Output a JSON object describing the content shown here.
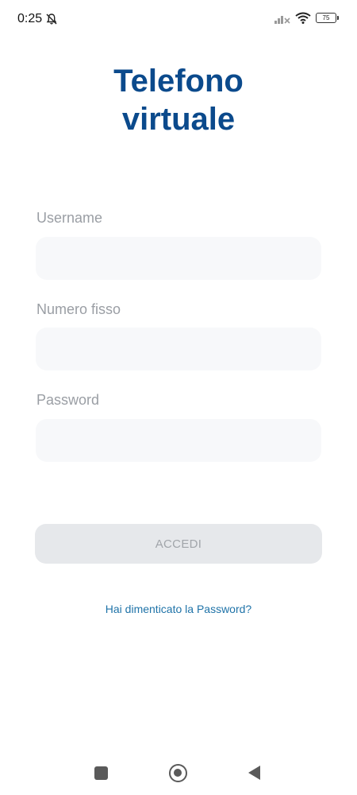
{
  "status_bar": {
    "time": "0:25",
    "battery_level": "75",
    "icons": [
      "bell-muted-icon",
      "signal-off-icon",
      "wifi-icon",
      "battery-icon"
    ]
  },
  "header": {
    "title_line1": "Telefono",
    "title_line2": "virtuale"
  },
  "form": {
    "username_label": "Username",
    "username_value": "",
    "landline_label": "Numero fisso",
    "landline_value": "",
    "password_label": "Password",
    "password_value": "",
    "submit_label": "ACCEDI",
    "forgot_link": "Hai dimenticato la Password?"
  },
  "nav_bar": {
    "icons": [
      "recents-icon",
      "home-icon",
      "back-icon"
    ]
  },
  "colors": {
    "title": "#0b4a8c",
    "link": "#1f73a8",
    "label": "#9a9ea4",
    "input_bg": "#f7f8fa",
    "button_disabled_bg": "#e6e8eb",
    "button_disabled_text": "#a1a5aa"
  }
}
